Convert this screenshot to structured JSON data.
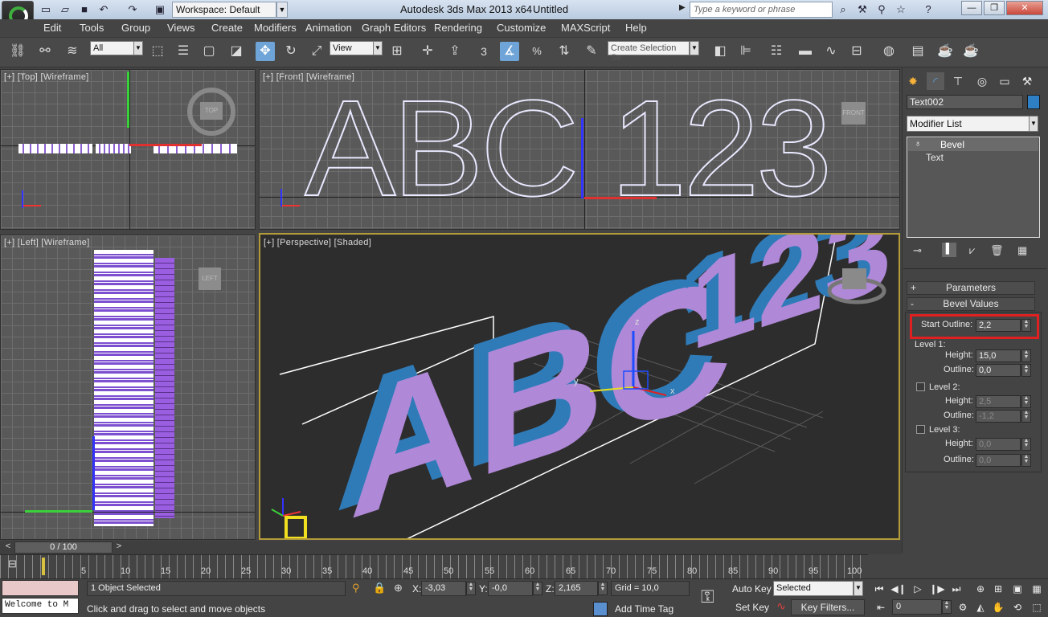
{
  "titlebar": {
    "workspace_label": "Workspace: Default",
    "app_title": "Autodesk 3ds Max  2013 x64",
    "document_title": "Untitled",
    "search_placeholder": "Type a keyword or phrase"
  },
  "menu": [
    "Edit",
    "Tools",
    "Group",
    "Views",
    "Create",
    "Modifiers",
    "Animation",
    "Graph Editors",
    "Rendering",
    "Customize",
    "MAXScript",
    "Help"
  ],
  "toolbar": {
    "selection_filter": "All",
    "reference_coord": "View",
    "angle_snap_value": "3",
    "named_selection_placeholder": "Create Selection Se"
  },
  "viewports": {
    "top": {
      "plus": "[+]",
      "name": "[Top]",
      "mode": "[Wireframe]",
      "cube_label": "TOP"
    },
    "front": {
      "plus": "[+]",
      "name": "[Front]",
      "mode": "[Wireframe]",
      "cube_label": "FRONT"
    },
    "left": {
      "plus": "[+]",
      "name": "[Left]",
      "mode": "[Wireframe]",
      "cube_label": "LEFT"
    },
    "perspective": {
      "plus": "[+]",
      "name": "[Perspective]",
      "mode": "[Shaded]"
    },
    "scene_text": {
      "letters": "ABC",
      "numbers": "123"
    },
    "axis": {
      "x": "x",
      "y": "y",
      "z": "z"
    }
  },
  "command_panel": {
    "object_name": "Text002",
    "object_color": "#2e7fc4",
    "modifier_list": "Modifier List",
    "stack": [
      "Bevel",
      "Text"
    ],
    "rollouts": {
      "parameters": "Parameters",
      "bevel_values": "Bevel Values",
      "parameters_toggle": "+",
      "bevel_values_toggle": "-"
    },
    "start_outline": {
      "label": "Start Outline:",
      "value": "2,2"
    },
    "level1": {
      "label": "Level 1:",
      "height_label": "Height:",
      "height": "15,0",
      "outline_label": "Outline:",
      "outline": "0,0"
    },
    "level2": {
      "label": "Level 2:",
      "height_label": "Height:",
      "height": "2,5",
      "outline_label": "Outline:",
      "outline": "-1,2",
      "checked": false
    },
    "level3": {
      "label": "Level 3:",
      "height_label": "Height:",
      "height": "0,0",
      "outline_label": "Outline:",
      "outline": "0,0",
      "checked": false
    }
  },
  "timeline": {
    "position": "0 / 100",
    "prev": "<",
    "next": ">",
    "ticks": [
      "5",
      "10",
      "15",
      "20",
      "25",
      "30",
      "35",
      "40",
      "45",
      "50",
      "55",
      "60",
      "65",
      "70",
      "75",
      "80",
      "85",
      "90",
      "95",
      "100"
    ]
  },
  "status": {
    "selection": "1 Object Selected",
    "prompt": "Click and drag to select and move objects",
    "x_label": "X:",
    "x": "-3,03",
    "y_label": "Y:",
    "y": "-0,0",
    "z_label": "Z:",
    "z": "2,165",
    "grid": "Grid = 10,0",
    "add_time_tag": "Add Time Tag",
    "auto_key": "Auto Key",
    "set_key": "Set Key",
    "key_mode": "Selected",
    "key_filters": "Key Filters...",
    "frame": "0",
    "listener": "Welcome to M"
  }
}
